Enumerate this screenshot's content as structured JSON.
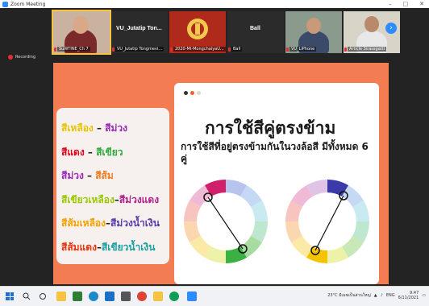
{
  "window": {
    "title": "Zoom Meeting",
    "controls": [
      "–",
      "□",
      "✕"
    ]
  },
  "participants": [
    {
      "name_top": "",
      "name_bottom": "SuWTINE_Ch 7",
      "speaking": true
    },
    {
      "name_top": "VU_Jutatip Ton...",
      "name_bottom": "VU_Jutatip Tongmevi...",
      "speaking": false
    },
    {
      "name_top": "",
      "name_bottom": "2020-MI-MongchaiyaU...",
      "speaking": false
    },
    {
      "name_top": "Ball",
      "name_bottom": "Ball",
      "speaking": false
    },
    {
      "name_top": "",
      "name_bottom": "VU_LiPhone",
      "speaking": false
    },
    {
      "name_top": "",
      "name_bottom": "Article Sirassgattl",
      "speaking": false
    }
  ],
  "recording": {
    "label": "Recording"
  },
  "slide": {
    "title": "การใช้สีคู่ตรงข้าม",
    "subtitle": "การใช้สีที่อยู่ตรงข้ามกันในวงล้อสี มีทั้งหมด 6 คู่",
    "pairs": [
      {
        "c1": "สีเหลือง",
        "c2": "สีม่วง",
        "c1_color": "#e8c400",
        "c2_color": "#9a2bb5"
      },
      {
        "c1": "สีแดง",
        "c2": "สีเขียว",
        "c1_color": "#e0001a",
        "c2_color": "#2faa3a"
      },
      {
        "c1": "สีม่วง",
        "c2": "สีส้ม",
        "c1_color": "#9a2bb5",
        "c2_color": "#f07a1a"
      },
      {
        "c1": "สีเขียวเหลือง",
        "c2": "สีม่วงแดง",
        "c1_color": "#9ac800",
        "c2_color": "#b0208a"
      },
      {
        "c1": "สีส้มเหลือง",
        "c2": "สีม่วงน้ำเงิน",
        "c1_color": "#f5a200",
        "c2_color": "#5a3aa8"
      },
      {
        "c1": "สีส้มแดง",
        "c2": "สีเขียวน้ำเงิน",
        "c1_color": "#e8300a",
        "c2_color": "#1aa0a0"
      }
    ],
    "separator": " – ",
    "dot_colors": [
      "#333333",
      "#f06030",
      "#d9d9d9"
    ]
  },
  "taskbar": {
    "weather": "23°C  มีเมฆเป็นส่วนใหญ่",
    "lang": "ENG",
    "time": "9:47",
    "date": "6/11/2021"
  },
  "colors": {
    "slide_bg": "#f47c52",
    "accent": "#2d8cff"
  }
}
